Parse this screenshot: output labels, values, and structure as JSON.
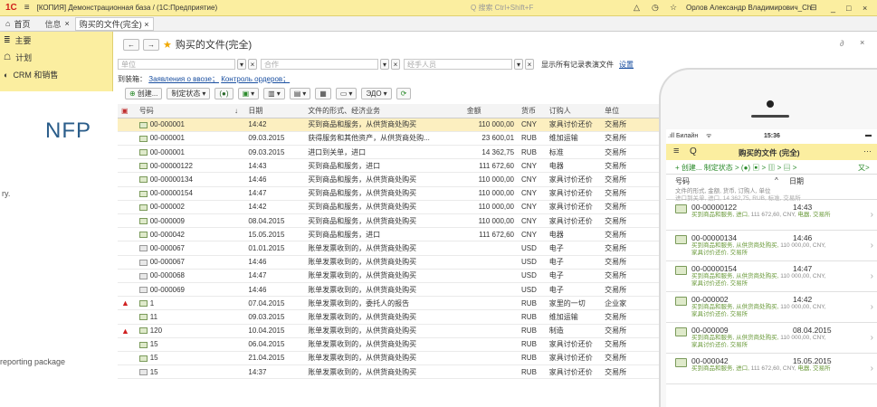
{
  "window": {
    "logo": "1С",
    "menu_icon": "≡",
    "title": "[КОПИЯ] Демонстрационная база / (1С:Предприятие)",
    "search_placeholder": "Q 搜索 Ctrl+Shift+F",
    "user": "Орлов Александр Владимирович_Ch",
    "bell_icon": "△",
    "history_icon": "◷",
    "star_icon": "☆",
    "sep_icon": "⊟",
    "min_icon": "_",
    "max_icon": "□",
    "close_icon": "×"
  },
  "tabs": {
    "home": "首页",
    "items": [
      {
        "label": "信息"
      },
      {
        "label": "购买的文件(完全)"
      }
    ]
  },
  "leftnav": {
    "items": [
      {
        "icon": "≣",
        "label": "主要"
      },
      {
        "icon": "☖",
        "label": "计划"
      },
      {
        "icon": "◐",
        "label": "CRM 和销售"
      }
    ]
  },
  "bg": {
    "brand": "NFP",
    "text1": "ry.",
    "text2": "reporting package"
  },
  "form": {
    "title": "购买的文件(完全)",
    "link_icon": "🔗",
    "close": "×",
    "filter": {
      "f1": "单位",
      "f2": "合作",
      "f3": "经手人员",
      "checkbox_label": "显示所有记录表演文件",
      "settings_link": "设置"
    },
    "hint_prefix": "到装箱：",
    "hint_link1": "Заявления о ввозе；",
    "hint_link2": "Контроль ордеров；",
    "toolbar": {
      "create": "创建...",
      "status": "制定状态",
      "edo": "(●)",
      "sdm": "▣",
      "print": "▤",
      "save": "▭",
      "sheet": "▥",
      "report": "▦",
      "edo2": "ЭДО",
      "refresh": "⟳"
    },
    "columns": [
      "号码",
      "日期",
      "文件的形式、经济业务",
      "金额",
      "货币",
      "订购人",
      "单位"
    ],
    "rows": [
      {
        "warn": false,
        "grey": false,
        "no": "00-000001",
        "date": "14:42",
        "type": "买到商品和服务，从供货商处购买",
        "sum": "110 000,00",
        "cur": "CNY",
        "cp": "家具讨价还价",
        "org": "交易所",
        "sel": true
      },
      {
        "warn": false,
        "grey": false,
        "no": "00-000001",
        "date": "09.03.2015",
        "type": "获得服务和其他资产，从供货商处购...",
        "sum": "23 600,01",
        "cur": "RUB",
        "cp": "维加运输",
        "org": "交易所"
      },
      {
        "warn": false,
        "grey": false,
        "no": "00-000001",
        "date": "09.03.2015",
        "type": "进口到关单，进口",
        "sum": "14 362,75",
        "cur": "RUB",
        "cp": "标准",
        "org": "交易所"
      },
      {
        "warn": false,
        "grey": false,
        "no": "00-00000122",
        "date": "14:43",
        "type": "买到商品和服务，进口",
        "sum": "111 672,60",
        "cur": "CNY",
        "cp": "电器",
        "org": "交易所"
      },
      {
        "warn": false,
        "grey": false,
        "no": "00-00000134",
        "date": "14:46",
        "type": "买到商品和服务，从供货商处购买",
        "sum": "110 000,00",
        "cur": "CNY",
        "cp": "家具讨价还价",
        "org": "交易所"
      },
      {
        "warn": false,
        "grey": false,
        "no": "00-00000154",
        "date": "14:47",
        "type": "买到商品和服务，从供货商处购买",
        "sum": "110 000,00",
        "cur": "CNY",
        "cp": "家具讨价还价",
        "org": "交易所"
      },
      {
        "warn": false,
        "grey": false,
        "no": "00-000002",
        "date": "14:42",
        "type": "买到商品和服务，从供货商处购买",
        "sum": "110 000,00",
        "cur": "CNY",
        "cp": "家具讨价还价",
        "org": "交易所"
      },
      {
        "warn": false,
        "grey": false,
        "no": "00-000009",
        "date": "08.04.2015",
        "type": "买到商品和服务，从供货商处购买",
        "sum": "110 000,00",
        "cur": "CNY",
        "cp": "家具讨价还价",
        "org": "交易所"
      },
      {
        "warn": false,
        "grey": false,
        "no": "00-000042",
        "date": "15.05.2015",
        "type": "买到商品和服务，进口",
        "sum": "111 672,60",
        "cur": "CNY",
        "cp": "电器",
        "org": "交易所"
      },
      {
        "warn": false,
        "grey": true,
        "no": "00-000067",
        "date": "01.01.2015",
        "type": "账单发票收到的，从供货商处购买",
        "sum": "",
        "cur": "USD",
        "cp": "电子",
        "org": "交易所"
      },
      {
        "warn": false,
        "grey": true,
        "no": "00-000067",
        "date": "14:46",
        "type": "账单发票收到的，从供货商处购买",
        "sum": "",
        "cur": "USD",
        "cp": "电子",
        "org": "交易所"
      },
      {
        "warn": false,
        "grey": true,
        "no": "00-000068",
        "date": "14:47",
        "type": "账单发票收到的，从供货商处购买",
        "sum": "",
        "cur": "USD",
        "cp": "电子",
        "org": "交易所"
      },
      {
        "warn": false,
        "grey": true,
        "no": "00-000069",
        "date": "14:46",
        "type": "账单发票收到的，从供货商处购买",
        "sum": "",
        "cur": "USD",
        "cp": "电子",
        "org": "交易所"
      },
      {
        "warn": true,
        "grey": false,
        "no": "1",
        "date": "07.04.2015",
        "type": "账单发票收到的，委托人的报告",
        "sum": "",
        "cur": "RUB",
        "cp": "家里的一切",
        "org": "企业家"
      },
      {
        "warn": false,
        "grey": false,
        "no": "11",
        "date": "09.03.2015",
        "type": "账单发票收到的，从供货商处购买",
        "sum": "",
        "cur": "RUB",
        "cp": "维加运输",
        "org": "交易所"
      },
      {
        "warn": true,
        "grey": false,
        "no": "120",
        "date": "10.04.2015",
        "type": "账单发票收到的，从供货商处购买",
        "sum": "",
        "cur": "RUB",
        "cp": "制造",
        "org": "交易所"
      },
      {
        "warn": false,
        "grey": false,
        "no": "15",
        "date": "06.04.2015",
        "type": "账单发票收到的，从供货商处购买",
        "sum": "",
        "cur": "RUB",
        "cp": "家具讨价还价",
        "org": "交易所"
      },
      {
        "warn": false,
        "grey": false,
        "no": "15",
        "date": "21.04.2015",
        "type": "账单发票收到的，从供货商处购买",
        "sum": "",
        "cur": "RUB",
        "cp": "家具讨价还价",
        "org": "交易所"
      },
      {
        "warn": false,
        "grey": true,
        "no": "15",
        "date": "14:37",
        "type": "账单发票收到的，从供货商处购买",
        "sum": "",
        "cur": "RUB",
        "cp": "家具讨价还价",
        "org": "交易所"
      }
    ]
  },
  "phone": {
    "carrier": ".ıll Билайн",
    "wifi": "ᯤ",
    "time": "15:36",
    "battery": "▬",
    "title": "购买的文件 (完全)",
    "menu": "≡",
    "search": "Q",
    "more": "···",
    "toolbar": "+ 创建... 制定状态 > (●) ▣ > ▥ > ▤ >",
    "toolbar_right": "又>",
    "col1": "号码",
    "col2": "日期",
    "colsub": "文件的形式, 金额, 货币, 订购人, 单位",
    "partial": "进口到关单, 进口, 14 362,75, RUB, 标准, 交易所",
    "items": [
      {
        "no": "00-00000122",
        "date": "14:43",
        "desc1": "买到商品和服务, 进口,",
        "amt": "111 672,60, CNY,",
        "desc2": "电器, 交易所",
        "desc3": ""
      },
      {
        "no": "00-00000134",
        "date": "14:46",
        "desc1": "买到商品和服务, 从供货商处购买,",
        "amt": "110 000,00, CNY,",
        "desc2": "",
        "desc3": "家具讨价还价, 交易所"
      },
      {
        "no": "00-00000154",
        "date": "14:47",
        "desc1": "买到商品和服务, 从供货商处购买,",
        "amt": "110 000,00, CNY,",
        "desc2": "",
        "desc3": "家具讨价还价, 交易所"
      },
      {
        "no": "00-000002",
        "date": "14:42",
        "desc1": "买到商品和服务, 从供货商处购买,",
        "amt": "110 000,00, CNY,",
        "desc2": "",
        "desc3": "家具讨价还价, 交易所"
      },
      {
        "no": "00-000009",
        "date": "08.04.2015",
        "desc1": "买到商品和服务, 从供货商处购买,",
        "amt": "110 000,00, CNY,",
        "desc2": "",
        "desc3": "家具讨价还价, 交易所"
      },
      {
        "no": "00-000042",
        "date": "15.05.2015",
        "desc1": "买到商品和服务, 进口,",
        "amt": "111 672,60, CNY,",
        "desc2": "电器, 交易所",
        "desc3": ""
      }
    ]
  }
}
